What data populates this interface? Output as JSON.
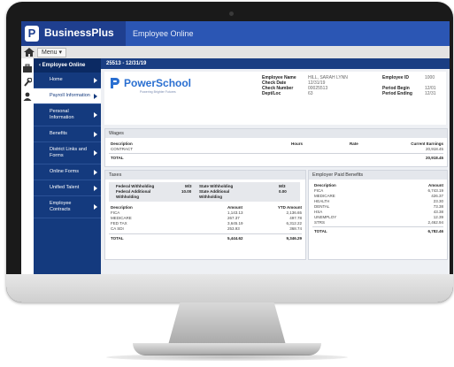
{
  "app": {
    "brand": "BusinessPlus",
    "logo_letter": "P",
    "title": "Employee Online",
    "menu_label": "Menu ▾"
  },
  "sidebar": {
    "header": "‹  Employee Online",
    "items": [
      {
        "label": "Home",
        "active": false
      },
      {
        "label": "Payroll Information",
        "active": true
      },
      {
        "label": "Personal Information",
        "active": false
      },
      {
        "label": "Benefits",
        "active": false
      },
      {
        "label": "District Links and Forms",
        "active": false
      },
      {
        "label": "Online Forms",
        "active": false
      },
      {
        "label": "Unified Talent",
        "active": false
      },
      {
        "label": "Employee Contracts",
        "active": false
      }
    ]
  },
  "stub": {
    "header": "25513 - 12/31/19",
    "org_name": "PowerSchool",
    "org_tagline": "Powering Brighter Futures",
    "employee_name_label": "Employee Name",
    "employee_name_value": "HILL, SARAH LYNN",
    "check_date_label": "Check Date",
    "check_date_value": "12/31/19",
    "check_number_label": "Check Number",
    "check_number_value": "00025513",
    "dept_label": "Dept/Loc",
    "dept_value": "63",
    "employee_id_label": "Employee ID",
    "employee_id_value": "1000",
    "period_begin_label": "Period Begin",
    "period_begin_value": "12/01",
    "period_ending_label": "Period Ending",
    "period_ending_value": "12/31"
  },
  "wages": {
    "title": "Wages",
    "col_description": "Description",
    "col_hours": "Hours",
    "col_rate": "Rate",
    "col_current": "Current Earnings",
    "rows": [
      {
        "description": "CONTRACT",
        "current": "20,918.45"
      }
    ],
    "total_label": "TOTAL",
    "total_value": "20,918.45"
  },
  "taxes": {
    "title": "Taxes",
    "info": [
      {
        "l1": "Federal Withholding",
        "v1": "M/3",
        "l2": "State Withholding",
        "v2": "M/3"
      },
      {
        "l1": "Federal Additional",
        "v1": "10.00",
        "l2": "State Additional",
        "v2": "0.00"
      },
      {
        "l1": "Withholding",
        "v1": "",
        "l2": "Withholding",
        "v2": ""
      }
    ],
    "col_description": "Description",
    "col_amount": "Amount",
    "col_ytd": "YTD Amount",
    "rows": [
      {
        "description": "FICA",
        "amount": "1,143.13",
        "ytd": "2,136.65"
      },
      {
        "description": "MEDICARE",
        "amount": "267.37",
        "ytd": "497.78"
      },
      {
        "description": "FED TAX",
        "amount": "3,645.19",
        "ytd": "6,312.22"
      },
      {
        "description": "CA SDI",
        "amount": "253.93",
        "ytd": "368.74"
      }
    ],
    "total_label": "TOTAL",
    "total_amount": "5,444.62",
    "total_ytd": "9,346.29"
  },
  "benefits": {
    "title": "Employer Paid Benefits",
    "col_description": "Description",
    "col_amount": "Amount",
    "rows": [
      {
        "description": "FICA",
        "amount": "6,743.19"
      },
      {
        "description": "MEDICARE",
        "amount": "426.37"
      },
      {
        "description": "HEALTH",
        "amount": "23.30"
      },
      {
        "description": "DENTAL",
        "amount": "73.38"
      },
      {
        "description": "HSA",
        "amount": "43.38"
      },
      {
        "description": "UNEMPLOY",
        "amount": "12.39"
      },
      {
        "description": "STRS",
        "amount": "2,462.94"
      }
    ],
    "total_label": "TOTAL",
    "total_value": "6,782.46"
  },
  "colors": {
    "brand_blue": "#1f3f8f",
    "nav_blue": "#143a7e",
    "powerschool_blue": "#2a6fd1"
  },
  "icons": {
    "home": "home-icon",
    "briefcase": "briefcase-icon",
    "wrench": "wrench-icon",
    "person": "person-icon"
  }
}
